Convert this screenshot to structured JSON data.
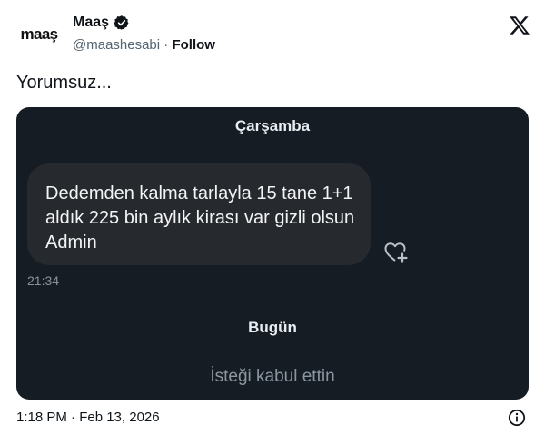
{
  "author": {
    "avatar_text": "maaş",
    "name": "Maaş",
    "handle": "@maashesabi",
    "separator": "·",
    "follow_label": "Follow"
  },
  "tweet": {
    "text": "Yorumsuz...",
    "timestamp": "1:18 PM · Feb 13, 2026"
  },
  "chat": {
    "day_label_1": "Çarşamba",
    "message": "Dedemden kalma tarlayla 15 tane 1+1 aldık 225 bin aylık kirası var gizli olsun Admin",
    "message_time": "21:34",
    "day_label_2": "Bugün",
    "request_status": "İsteği kabul ettin"
  },
  "icons": {
    "verified": "verified-badge-icon",
    "x_logo": "x-logo-icon",
    "heart_add": "heart-plus-icon",
    "info": "info-icon"
  },
  "colors": {
    "chat_background": "#151c23",
    "bubble": "#26292d",
    "muted_text": "#536471"
  }
}
